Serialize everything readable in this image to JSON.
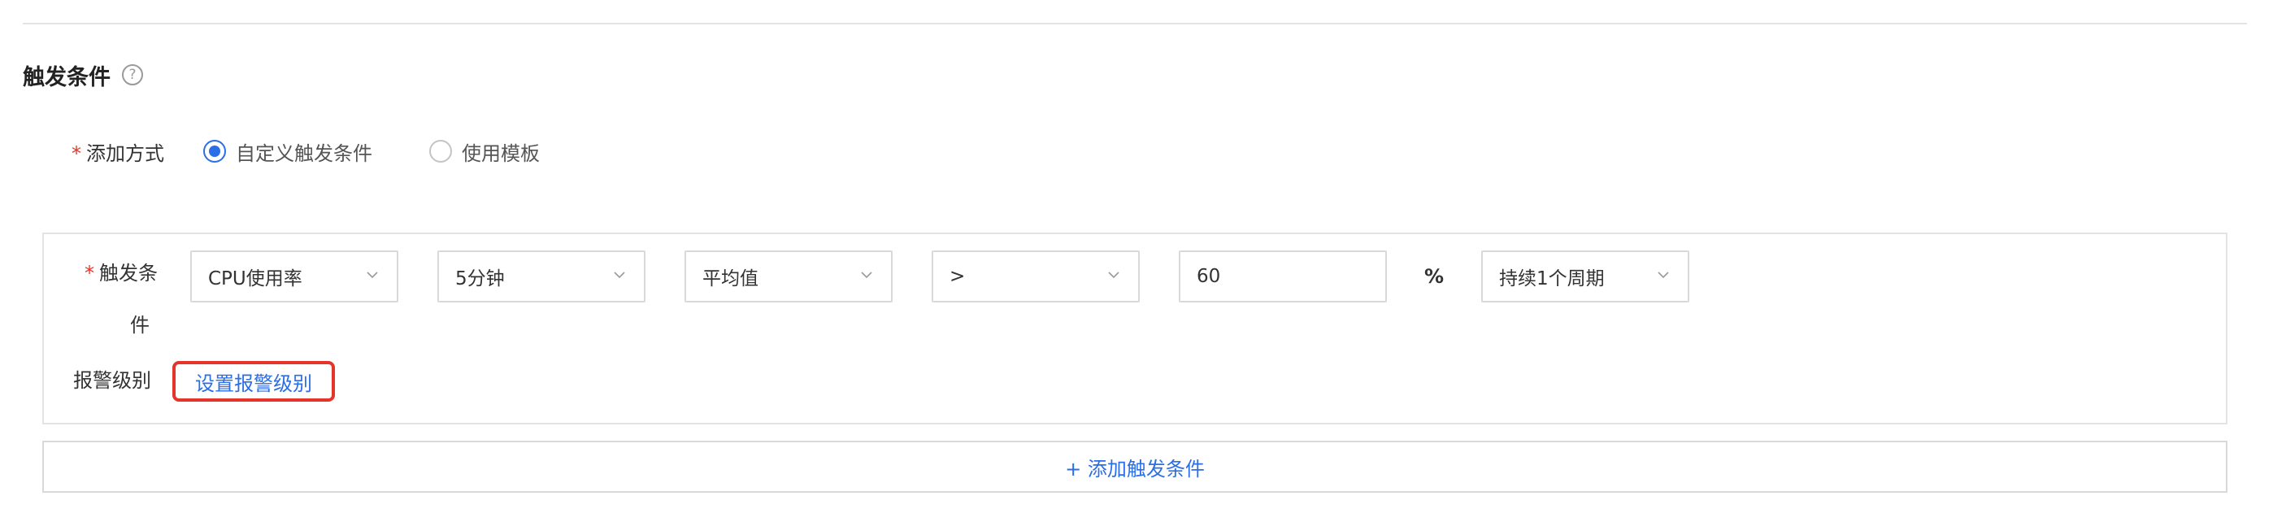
{
  "section": {
    "title": "触发条件",
    "help_glyph": "?"
  },
  "add_method": {
    "required_mark": "*",
    "label": "添加方式",
    "options": [
      {
        "label": "自定义触发条件",
        "checked": true
      },
      {
        "label": "使用模板",
        "checked": false
      }
    ]
  },
  "condition": {
    "required_mark": "*",
    "label_line1": "触发条",
    "label_line2": "件",
    "metric": "CPU使用率",
    "period": "5分钟",
    "statistic": "平均值",
    "operator": ">",
    "threshold": "60",
    "unit": "%",
    "duration": "持续1个周期"
  },
  "alarm_level": {
    "label": "报警级别",
    "link": "设置报警级别"
  },
  "add_condition_button": "+ 添加触发条件",
  "colors": {
    "accent": "#2a6ee8",
    "required": "#e5352b",
    "highlight_box": "#e5352b",
    "border": "#d9d9d9"
  }
}
